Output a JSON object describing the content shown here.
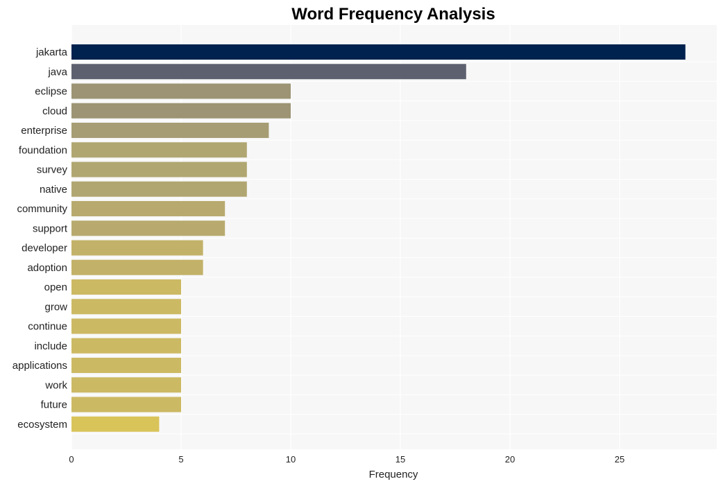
{
  "chart_data": {
    "type": "bar",
    "orientation": "horizontal",
    "title": "Word Frequency Analysis",
    "xlabel": "Frequency",
    "ylabel": "",
    "xlim": [
      0,
      29.4
    ],
    "xticks": [
      0,
      5,
      10,
      15,
      20,
      25
    ],
    "grid": true,
    "categories": [
      "jakarta",
      "java",
      "eclipse",
      "cloud",
      "enterprise",
      "foundation",
      "survey",
      "native",
      "community",
      "support",
      "developer",
      "adoption",
      "open",
      "grow",
      "continue",
      "include",
      "applications",
      "work",
      "future",
      "ecosystem"
    ],
    "values": [
      28,
      18,
      10,
      10,
      9,
      8,
      8,
      8,
      7,
      7,
      6,
      6,
      5,
      5,
      5,
      5,
      5,
      5,
      5,
      4
    ],
    "colors": [
      "#00224e",
      "#5d616f",
      "#9c9474",
      "#9c9474",
      "#a69d75",
      "#b0a671",
      "#b0a671",
      "#b0a671",
      "#b8aa6e",
      "#b8aa6e",
      "#c2b168",
      "#c2b168",
      "#ccb963",
      "#ccb963",
      "#ccb963",
      "#ccb963",
      "#ccb963",
      "#ccb963",
      "#ccb963",
      "#d9c45a"
    ],
    "background": "#f7f7f7"
  }
}
